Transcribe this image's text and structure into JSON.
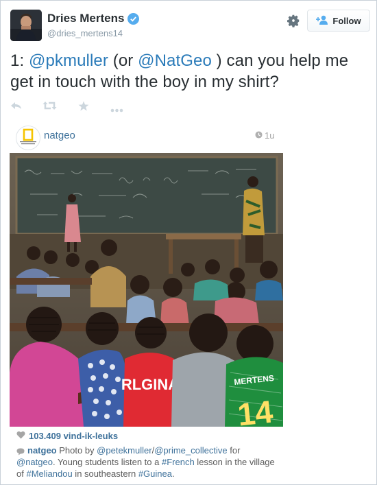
{
  "author": {
    "name": "Dries Mertens",
    "handle": "@dries_mertens14"
  },
  "header": {
    "follow_label": "Follow"
  },
  "tweet": {
    "parts": [
      {
        "text": "1: ",
        "type": "plain"
      },
      {
        "text": "@pkmuller",
        "type": "mention"
      },
      {
        "text": " (or ",
        "type": "plain"
      },
      {
        "text": "@NatGeo",
        "type": "mention"
      },
      {
        "text": " ) can you help me get in touch with the boy in my shirt?",
        "type": "plain"
      }
    ]
  },
  "actions": [
    "reply-icon",
    "retweet-icon",
    "favorite-icon",
    "more-icon"
  ],
  "embed": {
    "username": "natgeo",
    "time": "1u",
    "likes": "103.409 vind-ik-leuks",
    "jersey_texts": [
      "RLGINA",
      "MERTENS",
      "14"
    ],
    "caption": {
      "user": "natgeo",
      "parts": [
        {
          "text": " Photo by ",
          "type": "plain"
        },
        {
          "text": "@petekmuller",
          "type": "link"
        },
        {
          "text": "/",
          "type": "plain"
        },
        {
          "text": "@prime_collective",
          "type": "link"
        },
        {
          "text": " for ",
          "type": "plain"
        },
        {
          "text": "@natgeo",
          "type": "link"
        },
        {
          "text": ". Young students listen to a ",
          "type": "plain"
        },
        {
          "text": "#French",
          "type": "link"
        },
        {
          "text": " lesson in the village of ",
          "type": "plain"
        },
        {
          "text": "#Meliandou",
          "type": "link"
        },
        {
          "text": " in southeastern ",
          "type": "plain"
        },
        {
          "text": "#Guinea",
          "type": "link"
        },
        {
          "text": ".",
          "type": "plain"
        }
      ]
    }
  },
  "colors": {
    "twitter_link": "#2b7bb9",
    "instagram_link": "#3f729b",
    "verified": "#55acee"
  }
}
